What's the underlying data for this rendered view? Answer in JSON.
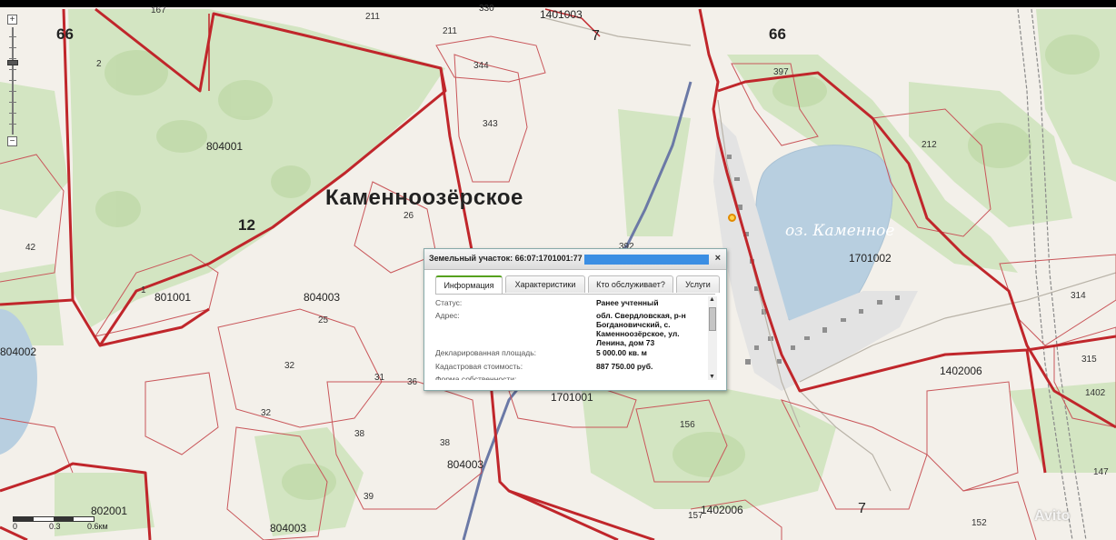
{
  "map": {
    "colors": {
      "boundary": "#c0262b",
      "thin_boundary": "#c9565a",
      "forest": "#cfe2bd",
      "field": "#f3f0ea",
      "water": "#b8cfe0",
      "lake_label": "#ffffff",
      "popup_accent": "#56a11f",
      "title_mask": "#3b8ee3"
    },
    "town_label": "Каменноозёрское",
    "lake_label": "оз. Каменное",
    "region_labels": [
      "66",
      "66",
      "12",
      "7",
      "7"
    ],
    "parcel_labels": [
      "167",
      "211",
      "330",
      "1401003",
      "211",
      "344",
      "343",
      "397",
      "2",
      "804001",
      "26",
      "212",
      "42",
      "1",
      "801001",
      "392",
      "804003",
      "25",
      "1701002",
      "804002",
      "314",
      "32",
      "31",
      "36",
      "1701001",
      "1402006",
      "315",
      "32",
      "156",
      "1402",
      "38",
      "39",
      "38",
      "804003",
      "147",
      "802001",
      "804003",
      "157",
      "1402006",
      "152"
    ]
  },
  "zoom": {
    "plus": "+",
    "minus": "−"
  },
  "scale": {
    "labels": [
      "0",
      "0.3",
      "0.6км"
    ]
  },
  "popup": {
    "title": "Земельный участок: 66:07:1701001:77",
    "close": "×",
    "tabs": [
      "Информация",
      "Характеристики",
      "Кто обслуживает?",
      "Услуги"
    ],
    "active_tab": 0,
    "props": [
      {
        "key": "Статус:",
        "value": "Ранее учтенный"
      },
      {
        "key": "Адрес:",
        "value": "обл. Свердловская, р-н Богдановичский, с. Каменноозёрское, ул. Ленина, дом 73"
      },
      {
        "key": "Декларированная площадь:",
        "value": "5 000.00 кв. м"
      },
      {
        "key": "Кадастровая стоимость:",
        "value": "887 750.00 руб."
      },
      {
        "key": "Форма собственности:",
        "value": ""
      }
    ],
    "scroll": {
      "up": "▲",
      "down": "▼"
    }
  },
  "watermark": "Avito"
}
